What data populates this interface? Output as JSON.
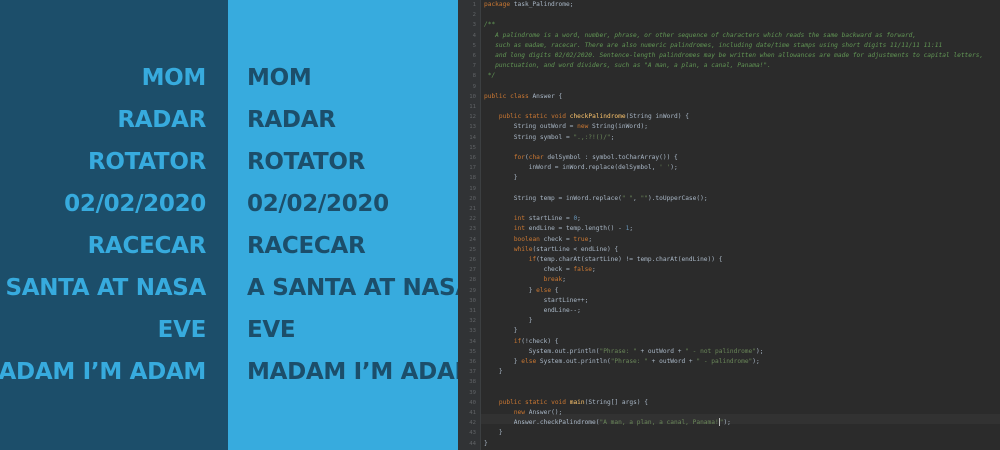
{
  "words": [
    "MOM",
    "RADAR",
    "ROTATOR",
    "02/02/2020",
    "RACECAR",
    "A SANTA AT NASA",
    "EVE",
    "MADAM I’M ADAM"
  ],
  "editor": {
    "lines": [
      "package task_Palindrome;",
      "",
      "/**",
      "   A palindrome is a word, number, phrase, or other sequence of characters which reads the same backward as forward,",
      "   such as madam, racecar. There are also numeric palindromes, including date/time stamps using short digits 11/11/11 11:11",
      "   and long digits 02/02/2020. Sentence-length palindromes may be written when allowances are made for adjustments to capital letters,",
      "   punctuation, and word dividers, such as \"A man, a plan, a canal, Panama!\".",
      " */",
      "",
      "public class Answer {",
      "",
      "    public static void checkPalindrome(String inWord) {",
      "        String outWord = new String(inWord);",
      "        String symbol = \".,:?!()/\";",
      "",
      "        for(char delSymbol : symbol.toCharArray()) {",
      "            inWord = inWord.replace(delSymbol, ' ');",
      "        }",
      "",
      "        String temp = inWord.replace(\" \", \"\").toUpperCase();",
      "",
      "        int startLine = 0;",
      "        int endLine = temp.length() - 1;",
      "        boolean check = true;",
      "        while(startLine < endLine) {",
      "            if(temp.charAt(startLine) != temp.charAt(endLine)) {",
      "                check = false;",
      "                break;",
      "            } else {",
      "                startLine++;",
      "                endLine--;",
      "            }",
      "        }",
      "        if(!check) {",
      "            System.out.println(\"Phrase: \" + outWord + \" - not palindrome\");",
      "        } else System.out.println(\"Phrase: \" + outWord + \" - palindrome\");",
      "    }",
      "",
      "",
      "    public static void main(String[] args) {",
      "        new Answer();",
      "        Answer.checkPalindrome(\"A man, a plan, a canal, Panama!\");",
      "    }",
      "}"
    ]
  },
  "colors": {
    "dark_blue": "#1c4e6a",
    "light_blue": "#37abde",
    "editor_bg": "#2b2b2b"
  }
}
